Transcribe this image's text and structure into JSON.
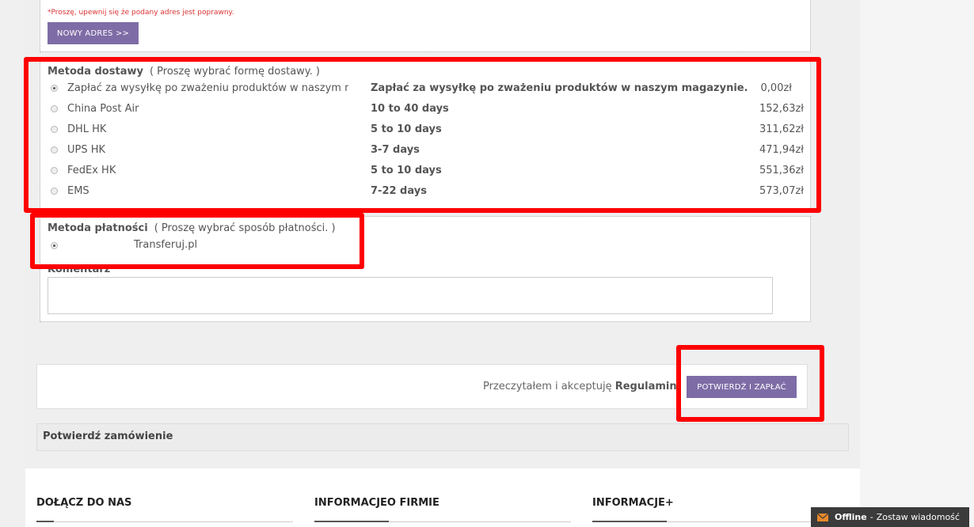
{
  "address": {
    "warning": "*Proszę, upewnij się że podany adres jest poprawny.",
    "new_address_button": "NOWY ADRES >>"
  },
  "shipping": {
    "title": "Metoda dostawy",
    "hint": "( Proszę wybrać formę dostawy. )",
    "options": [
      {
        "name": "Zapłać za wysyłkę po zważeniu produktów w naszym m",
        "desc": "Zapłać za wysyłkę po zważeniu produktów w naszym magazynie.",
        "price": "0,00zł",
        "selected": true
      },
      {
        "name": "China Post Air",
        "desc": "10 to 40 days",
        "price": "152,63zł",
        "selected": false
      },
      {
        "name": "DHL HK",
        "desc": "5 to 10 days",
        "price": "311,62zł",
        "selected": false
      },
      {
        "name": "UPS HK",
        "desc": "3-7 days",
        "price": "471,94zł",
        "selected": false
      },
      {
        "name": "FedEx HK",
        "desc": "5 to 10 days",
        "price": "551,36zł",
        "selected": false
      },
      {
        "name": "EMS",
        "desc": "7-22 days",
        "price": "573,07zł",
        "selected": false
      }
    ]
  },
  "payment": {
    "title": "Metoda płatności",
    "hint": "( Proszę wybrać sposób płatności. )",
    "option": "Transferuj.pl"
  },
  "comment": {
    "label": "Komentarz",
    "value": ""
  },
  "confirm": {
    "accept_text": "Przeczytałem i akceptuję",
    "terms_link": "Regulamin",
    "pay_button": "POTWIERDŹ I ZAPŁAĆ",
    "section_title": "Potwierdź zamówienie"
  },
  "footer": {
    "col1": "DOŁĄCZ DO NAS",
    "col2": "INFORMACJEO FIRMIE",
    "col3": "INFORMACJE+"
  },
  "chat": {
    "status": "Offline",
    "separator": "-",
    "action": "Zostaw wiadomość"
  },
  "colors": {
    "accent": "#7e6ca6",
    "highlight": "#ff0000"
  }
}
